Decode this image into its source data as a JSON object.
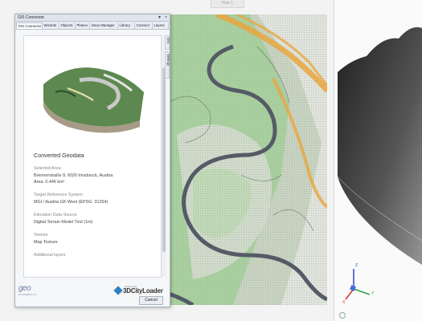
{
  "viewport": {
    "plan_tab": "Plan 1"
  },
  "dialog": {
    "title": "GIS Connector",
    "controls": {
      "pin": "▼",
      "close": "×"
    },
    "tabs": [
      "GIS Connector",
      "Wizards",
      "Objects",
      "Planes",
      "Issue Manager",
      "Library",
      "Connect",
      "Layers"
    ],
    "side_tabs": [
      "GIS",
      "Settings"
    ],
    "info": {
      "heading": "Converted Geodata",
      "selected_area_label": "Selected Area",
      "address": "Brennerstraße 9, 6020 Innsbruck, Austria",
      "area": "Area: 0.446 km²",
      "crs_label": "Target Reference System",
      "crs_value": "MGI / Austria GK West (EPSG: 31254)",
      "elevation_label": "Elevation Data Source",
      "elevation_value": "Digital Terrain Model Tirol (1m)",
      "texture_label": "Texture",
      "texture_value": "Map Texture",
      "additional_label": "Additional layers"
    },
    "footer": {
      "geo_logo": "geo",
      "geo_sub": "ENGINEERS AG",
      "powered_by": "powered by",
      "city_logo": "3DCityLoader",
      "cancel": "Cancel"
    }
  },
  "axes_gizmo": {
    "x": "X",
    "y": "Y",
    "z": "Z"
  },
  "colors": {
    "road": "#e8a640",
    "river": "#555b66",
    "terrain": "#8fc58a",
    "dialog_border": "#a9b3c2"
  }
}
